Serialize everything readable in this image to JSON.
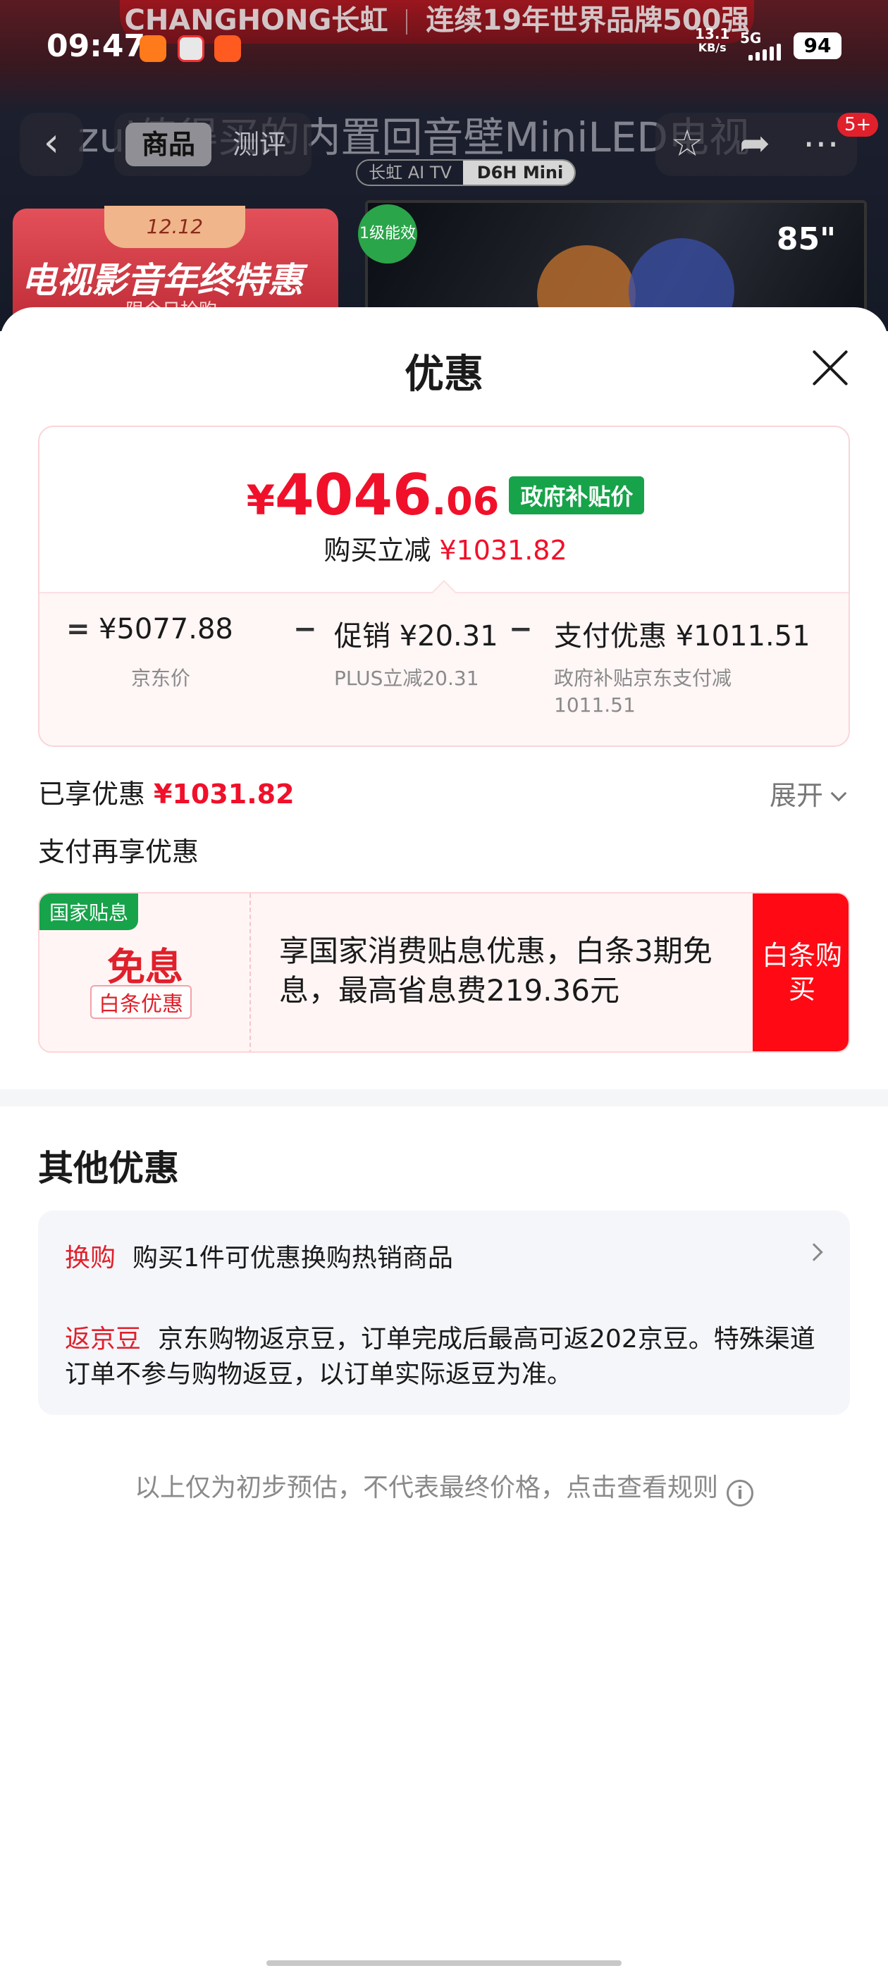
{
  "status_bar": {
    "time": "09:47",
    "net_speed": "13.1",
    "net_unit": "KB/s",
    "network_type": "5G",
    "battery": "94"
  },
  "background": {
    "banner_brand": "CHANGHONG长虹",
    "banner_slogan": "连续19年世界品牌500强",
    "product_title": "zui值得买的内置回音壁MiniLED电视",
    "tab_product": "商品",
    "tab_review": "测评",
    "badge": "5+",
    "model_left": "长虹 AI TV",
    "model_right": "D6H Mini",
    "promo_tag": "12.12",
    "promo_title": "电视影音年终特惠",
    "promo_sub": "限今日抢购",
    "energy_label": "1级能效",
    "tv_size": "85\""
  },
  "sheet": {
    "title": "优惠",
    "price": {
      "symbol": "¥",
      "integer": "4046",
      "decimal": ".06",
      "tag": "政府补贴价",
      "save_label": "购买立减",
      "save_amount": "¥1031.82"
    },
    "calc": {
      "eq": "=",
      "minus": "−",
      "jd_price": "¥5077.88",
      "jd_price_label": "京东价",
      "promo": "促销 ¥20.31",
      "promo_label": "PLUS立减20.31",
      "pay": "支付优惠 ¥1011.51",
      "pay_label": "政府补贴京东支付减",
      "pay_label2": "1011.51"
    },
    "enjoyed_label": "已享优惠",
    "enjoyed_amount": "¥1031.82",
    "expand_label": "展开",
    "pay_more_title": "支付再享优惠",
    "offer": {
      "tag": "国家贴息",
      "big": "免息",
      "small": "白条优惠",
      "desc": "享国家消费贴息优惠，白条3期免息，最高省息费219.36元",
      "button": "白条购买"
    },
    "other_title": "其他优惠",
    "other": [
      {
        "label": "换购",
        "text": "购买1件可优惠换购热销商品"
      },
      {
        "label": "返京豆",
        "text": "京东购物返京豆，订单完成后最高可返202京豆。特殊渠道订单不参与购物返豆，以订单实际返豆为准。"
      }
    ],
    "disclaimer": "以上仅为初步预估，不代表最终价格，点击查看规则",
    "info_icon": "i"
  },
  "colors": {
    "accent_red": "#f0102a",
    "gov_green": "#17a34a",
    "button_red": "#ff0a14"
  }
}
